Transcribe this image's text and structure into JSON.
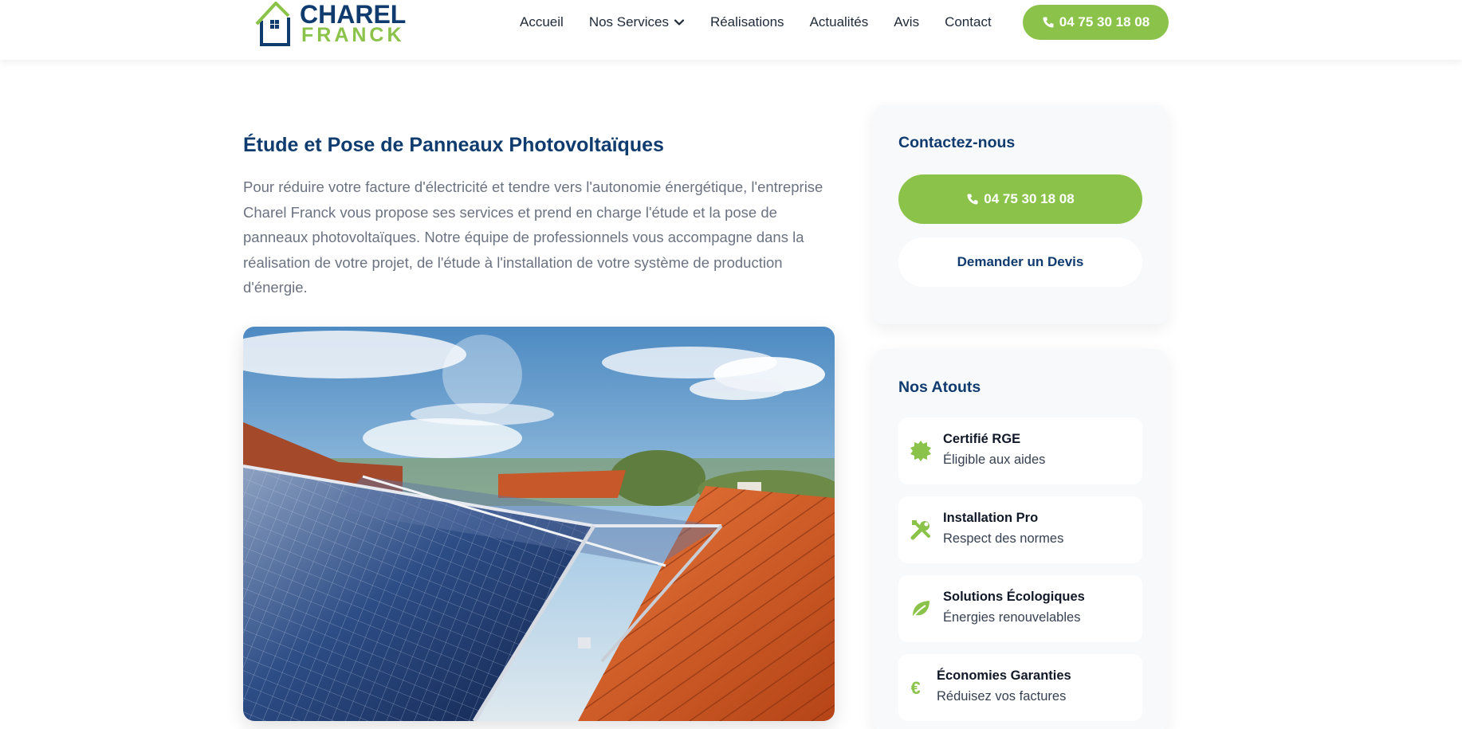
{
  "brand": {
    "line1": "CHAREL",
    "line2": "FRANCK",
    "green": "#8bc34a",
    "navy": "#0f3b6e"
  },
  "nav": {
    "items": [
      "Accueil",
      "Nos Services",
      "Réalisations",
      "Actualités",
      "Avis",
      "Contact"
    ],
    "phone": "04 75 30 18 08"
  },
  "main": {
    "title": "Étude et Pose de Panneaux Photovoltaïques",
    "intro": "Pour réduire votre facture d'électricité et tendre vers l'autonomie énergétique, l'entreprise Charel Franck vous propose ses services et prend en charge l'étude et la pose de panneaux photovoltaïques. Notre équipe de professionnels vous accompagne dans la réalisation de votre projet, de l'étude à l'installation de votre système de production d'énergie."
  },
  "contact": {
    "title": "Contactez-nous",
    "phone": "04 75 30 18 08",
    "devis": "Demander un Devis"
  },
  "atouts": {
    "title": "Nos Atouts",
    "items": [
      {
        "icon": "certificate-icon",
        "title": "Certifié RGE",
        "sub": "Éligible aux aides"
      },
      {
        "icon": "tools-icon",
        "title": "Installation Pro",
        "sub": "Respect des normes"
      },
      {
        "icon": "leaf-icon",
        "title": "Solutions Écologiques",
        "sub": "Énergies renouvelables"
      },
      {
        "icon": "euro-icon",
        "title": "Économies Garanties",
        "sub": "Réduisez vos factures"
      }
    ]
  }
}
